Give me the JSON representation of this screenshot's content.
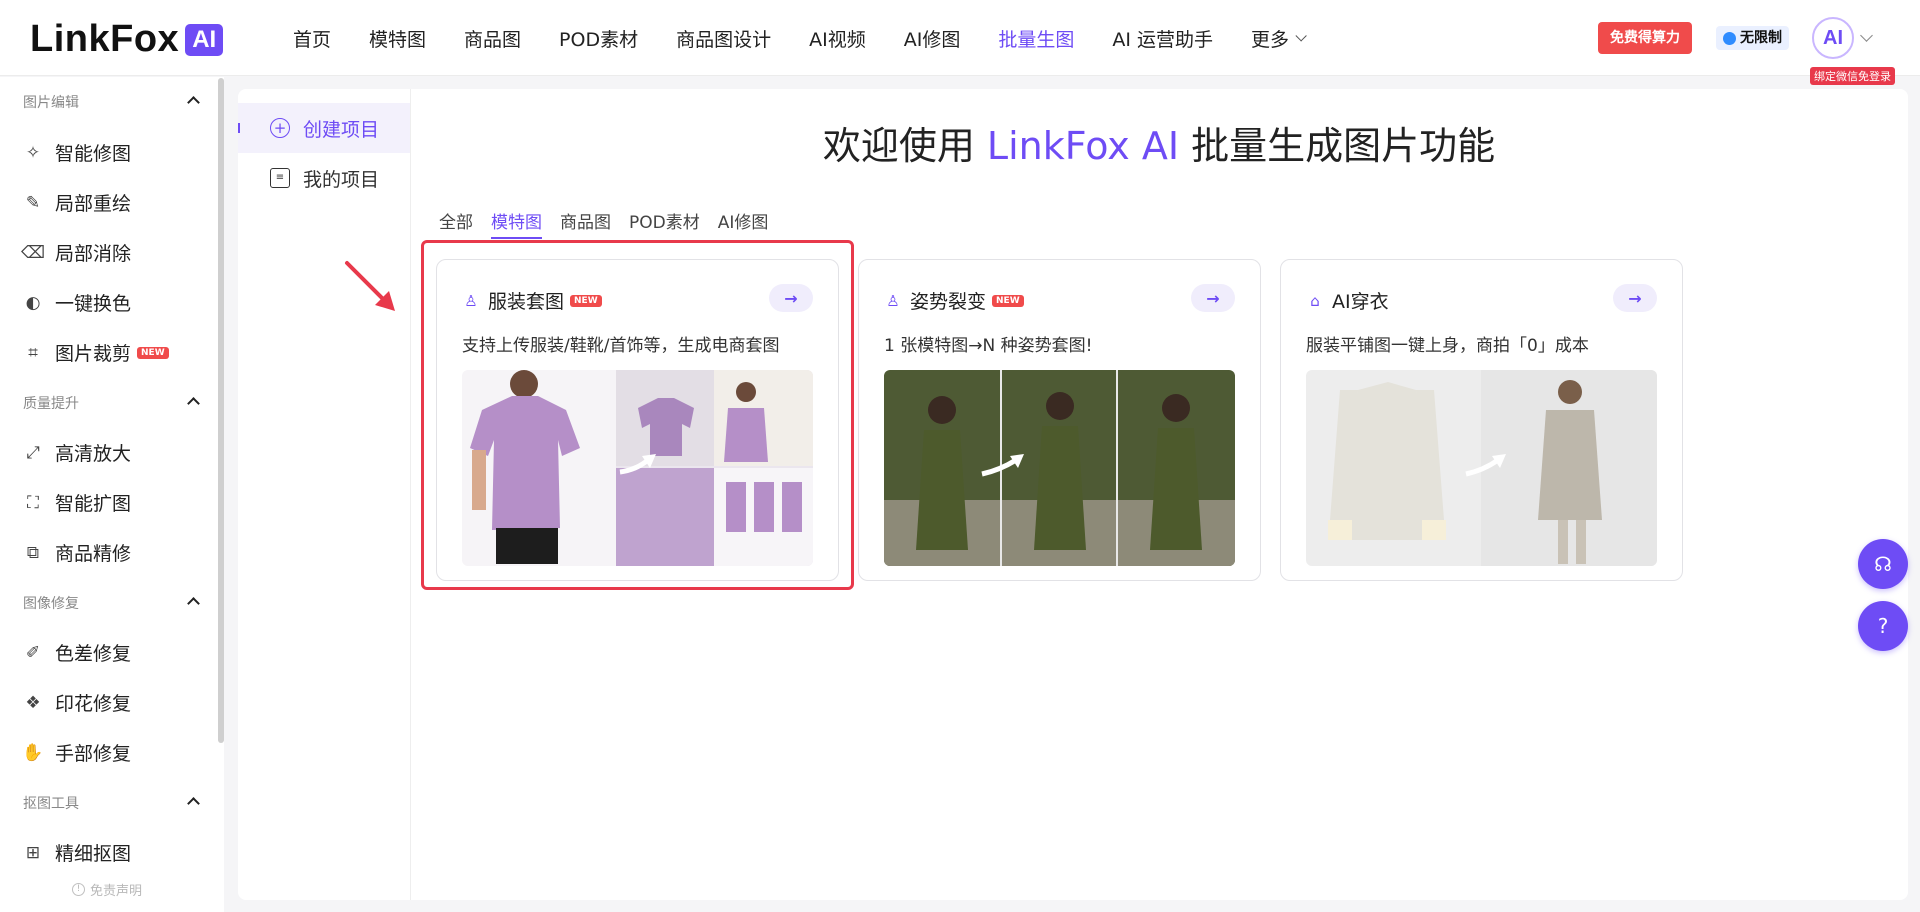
{
  "brand": {
    "name": "LinkFox",
    "badge": "AI"
  },
  "nav": {
    "items": [
      "首页",
      "模特图",
      "商品图",
      "POD素材",
      "商品图设计",
      "AI视频",
      "AI修图",
      "批量生图",
      "AI 运营助手",
      "更多"
    ],
    "active": "批量生图"
  },
  "header": {
    "free_button": "免费得算力",
    "unlimited": "无限制",
    "avatar": "AI",
    "bind_tip": "绑定微信免登录"
  },
  "sidebar": {
    "groups": [
      {
        "title": "图片编辑",
        "items": [
          {
            "label": "智能修图",
            "icon": "magic-wand-icon"
          },
          {
            "label": "局部重绘",
            "icon": "brush-icon"
          },
          {
            "label": "局部消除",
            "icon": "eraser-icon"
          },
          {
            "label": "一键换色",
            "icon": "palette-icon"
          },
          {
            "label": "图片裁剪",
            "icon": "crop-icon",
            "badge": "NEW"
          }
        ]
      },
      {
        "title": "质量提升",
        "items": [
          {
            "label": "高清放大",
            "icon": "upscale-icon"
          },
          {
            "label": "智能扩图",
            "icon": "expand-icon"
          },
          {
            "label": "商品精修",
            "icon": "retouch-icon"
          }
        ]
      },
      {
        "title": "图像修复",
        "items": [
          {
            "label": "色差修复",
            "icon": "color-fix-icon"
          },
          {
            "label": "印花修复",
            "icon": "print-fix-icon"
          },
          {
            "label": "手部修复",
            "icon": "hand-icon"
          }
        ]
      },
      {
        "title": "抠图工具",
        "items": [
          {
            "label": "精细抠图",
            "icon": "cutout-icon"
          }
        ]
      }
    ],
    "disclaimer": "免责声明"
  },
  "subnav": {
    "create": "创建项目",
    "mine": "我的项目"
  },
  "main": {
    "headline_pre": "欢迎使用 ",
    "headline_brand": "LinkFox AI",
    "headline_post": " 批量生成图片功能",
    "tabs": [
      "全部",
      "模特图",
      "商品图",
      "POD素材",
      "AI修图"
    ],
    "active_tab": "模特图",
    "cards": [
      {
        "title": "服装套图",
        "badge": "NEW",
        "desc": "支持上传服装/鞋靴/首饰等，生成电商套图"
      },
      {
        "title": "姿势裂变",
        "badge": "NEW",
        "desc": "1 张模特图→N 种姿势套图!"
      },
      {
        "title": "AI穿衣",
        "desc": "服装平铺图一键上身，商拍「0」成本"
      }
    ]
  },
  "colors": {
    "accent": "#6e4cf5",
    "highlight": "#e8394b",
    "free_button": "#f04b4b"
  }
}
